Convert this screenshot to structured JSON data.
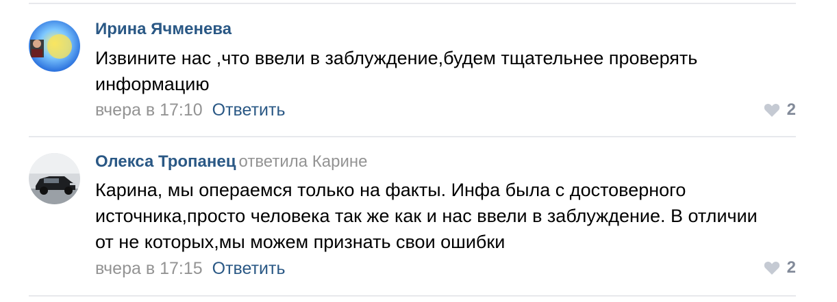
{
  "comments": [
    {
      "author": "Ирина Ячменева",
      "reply_to": "",
      "text": "Извините нас ,что ввели в заблуждение,будем тщательнее проверять информацию",
      "time": "вчера в 17:10",
      "reply_label": "Ответить",
      "likes": "2"
    },
    {
      "author": "Олекса Тропанец",
      "reply_to": "ответила Карине",
      "text": "Карина, мы операемся только на факты. Инфа была с достоверного источника,просто человека так же как и нас ввели в заблуждение. В отличии от не которых,мы можем признать свои ошибки",
      "time": "вчера в 17:15",
      "reply_label": "Ответить",
      "likes": "2"
    }
  ],
  "colors": {
    "link": "#2a5885",
    "muted": "#939393",
    "divider": "#e7e8ec",
    "like_icon": "#c5cad3"
  }
}
